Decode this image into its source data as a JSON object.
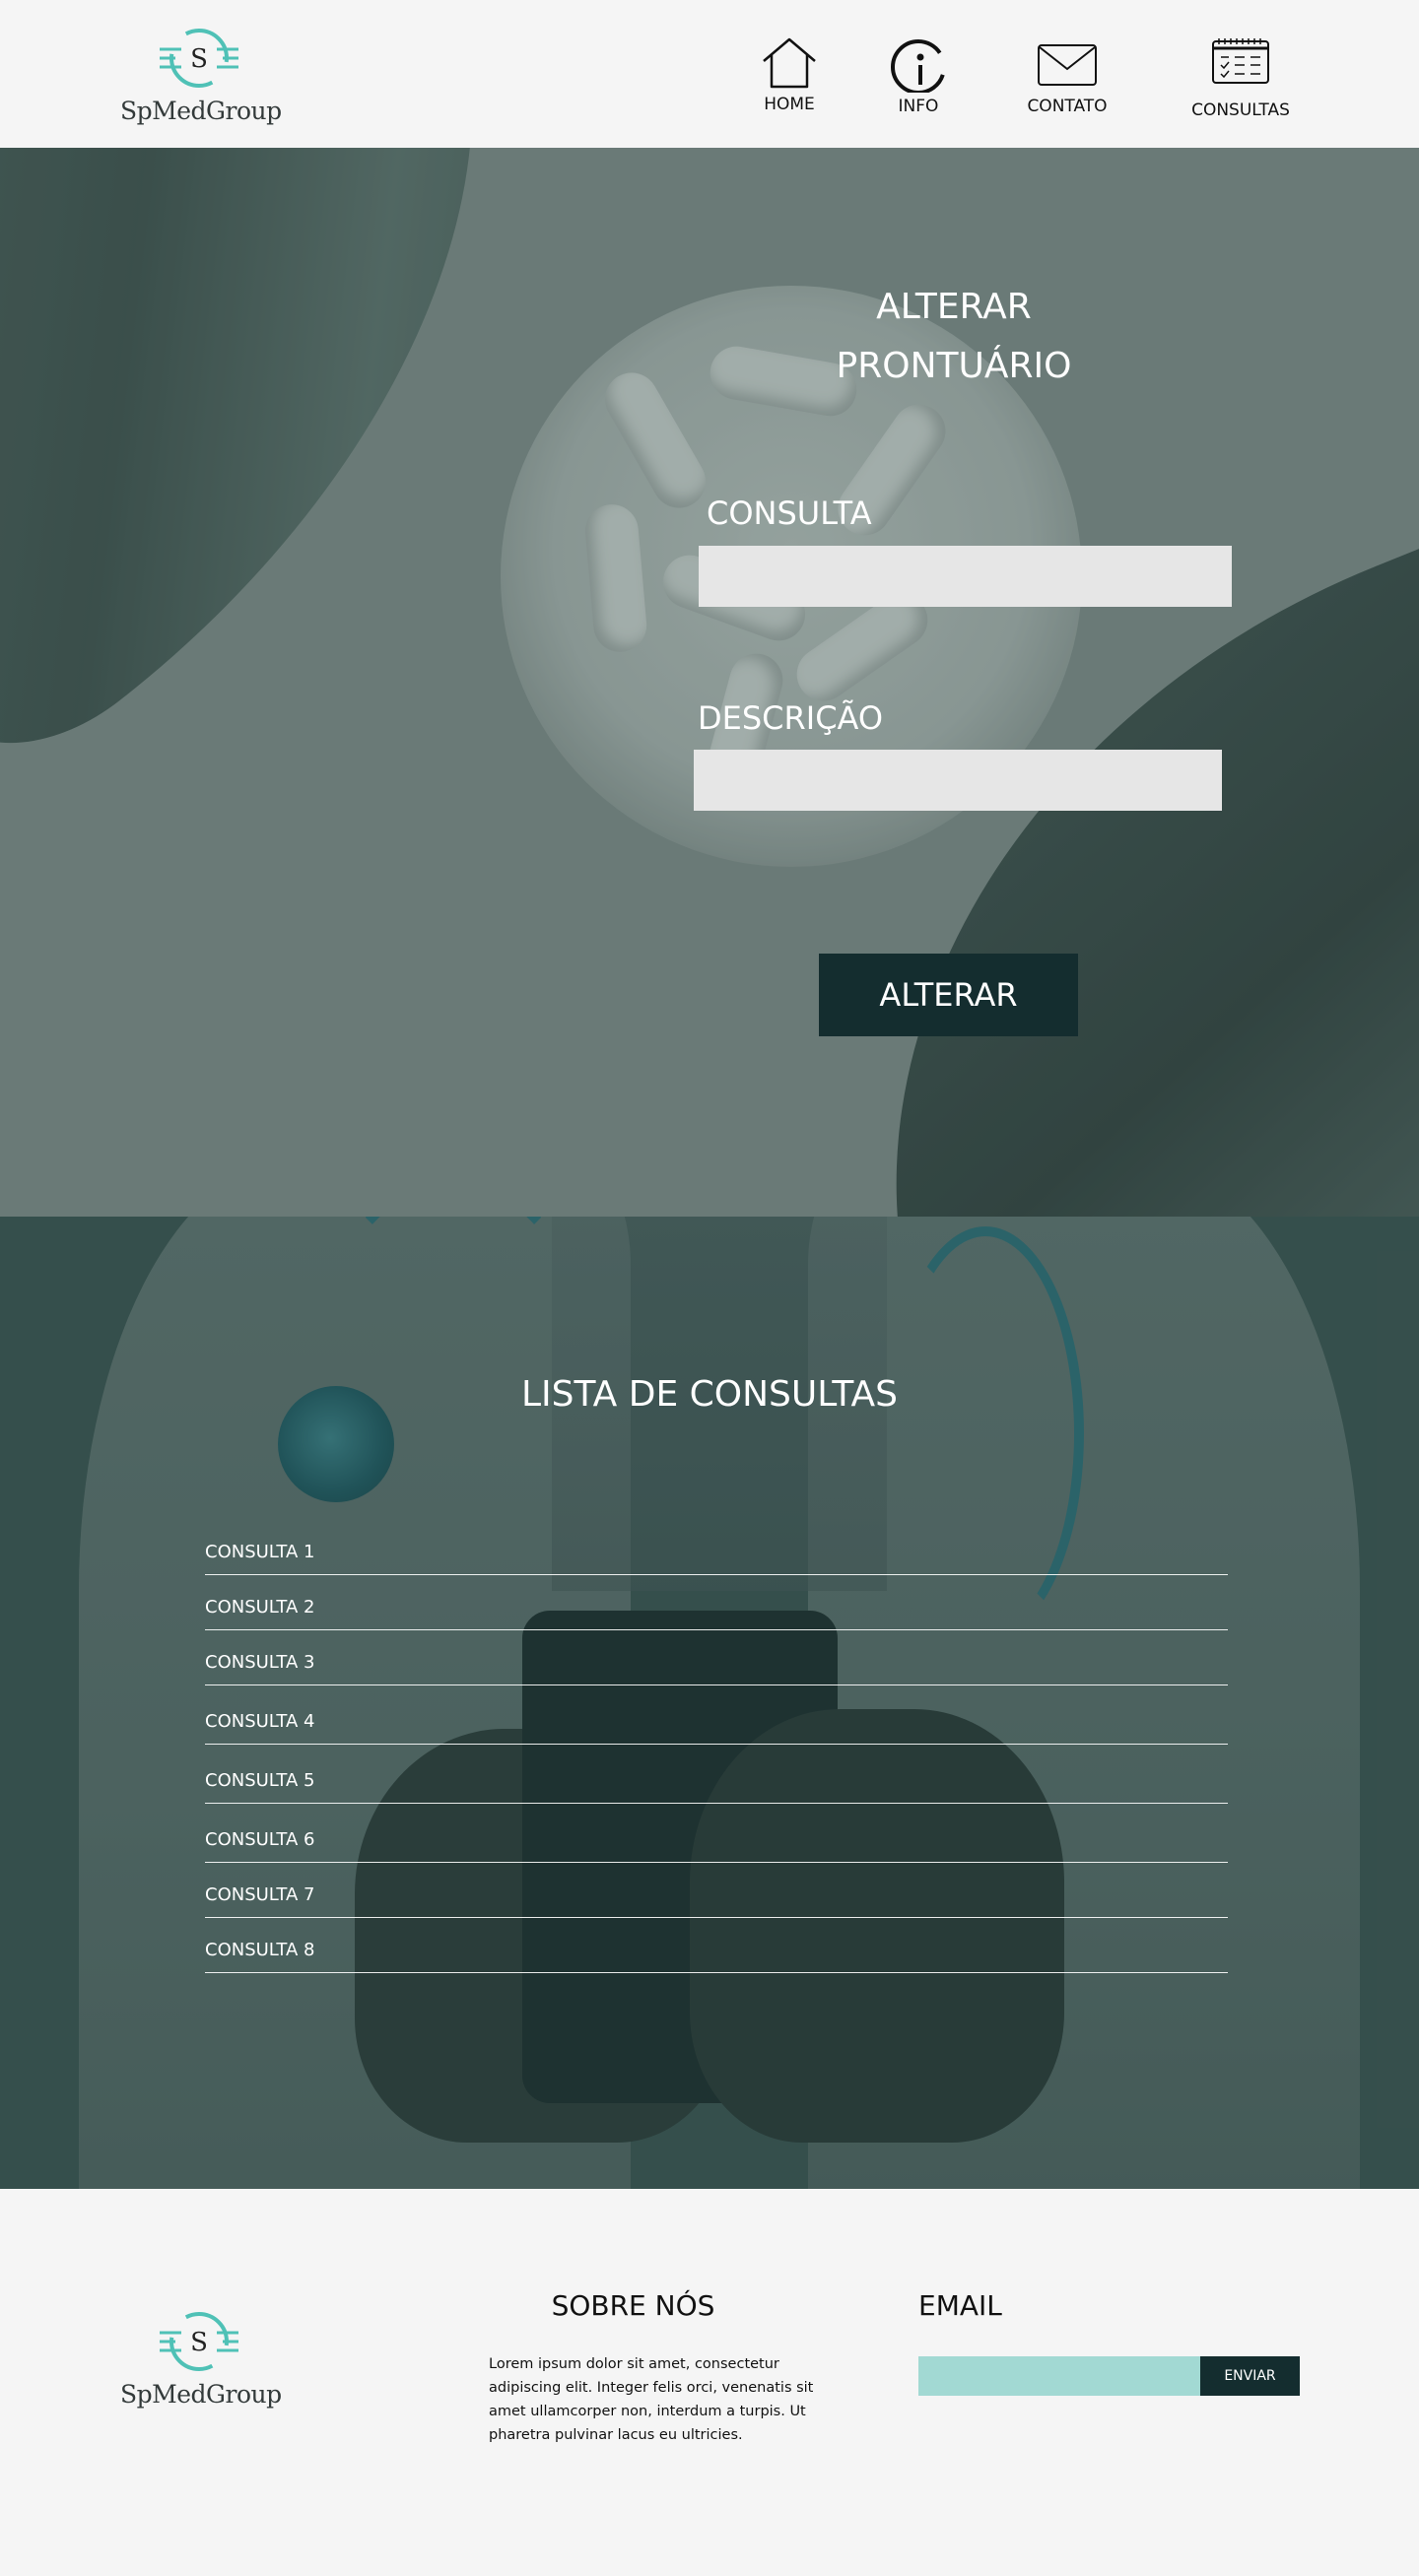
{
  "header": {
    "brand": "SpMedGroup",
    "logo_letter": "S",
    "nav": [
      {
        "label": "HOME",
        "icon": "home-icon"
      },
      {
        "label": "INFO",
        "icon": "info-icon"
      },
      {
        "label": "CONTATO",
        "icon": "mail-icon"
      },
      {
        "label": "CONSULTAS",
        "icon": "calendar-icon"
      }
    ]
  },
  "form": {
    "title_line1": "ALTERAR",
    "title_line2": "PRONTUÁRIO",
    "consulta_label": "CONSULTA",
    "consulta_value": "",
    "descricao_label": "DESCRIÇÃO",
    "descricao_value": "",
    "submit_label": "ALTERAR"
  },
  "consultas": {
    "title": "LISTA DE CONSULTAS",
    "items": [
      "CONSULTA 1",
      "CONSULTA 2",
      "CONSULTA 3",
      "CONSULTA 4",
      "CONSULTA 5",
      "CONSULTA 6",
      "CONSULTA 7",
      "CONSULTA 8"
    ]
  },
  "footer": {
    "brand": "SpMedGroup",
    "logo_letter": "S",
    "about_title": "SOBRE NÓS",
    "about_text": "Lorem ipsum dolor sit amet, consectetur adipiscing elit. Integer felis orci, venenatis sit amet ullamcorper non, interdum a turpis. Ut pharetra pulvinar lacus eu ultricies.",
    "email_title": "EMAIL",
    "email_value": "",
    "email_button": "ENVIAR"
  },
  "colors": {
    "accent": "#4fc1b6",
    "dark_button": "#142d2f",
    "input_bg": "#e6e6e6",
    "email_input_bg": "#a2d9d3",
    "page_bg": "#f5f5f5"
  }
}
